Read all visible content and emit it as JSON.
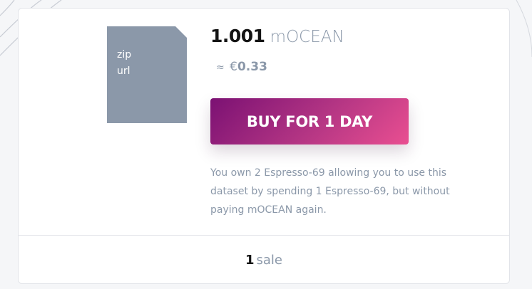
{
  "background": {
    "color": "#f5f6f8",
    "line_color": "#c8ccd4"
  },
  "asset": {
    "file_icon": {
      "icon": "file-icon",
      "color": "#8b98a9",
      "labels": [
        "zip",
        "url"
      ]
    },
    "price": {
      "amount": "1.001",
      "token_symbol": "mOCEAN"
    },
    "fiat": {
      "approx_sign": "≈",
      "currency_symbol": "€",
      "value": "0.33"
    },
    "buy_button": {
      "label": "BUY FOR 1 DAY",
      "gradient_start": "#7b1173",
      "gradient_end": "#e94f91"
    },
    "ownership_note": "You own 2 Espresso-69 allowing you to use this dataset by spending 1 Espresso-69, but without paying mOCEAN again.",
    "sales": {
      "count": "1",
      "label": "sale"
    }
  }
}
